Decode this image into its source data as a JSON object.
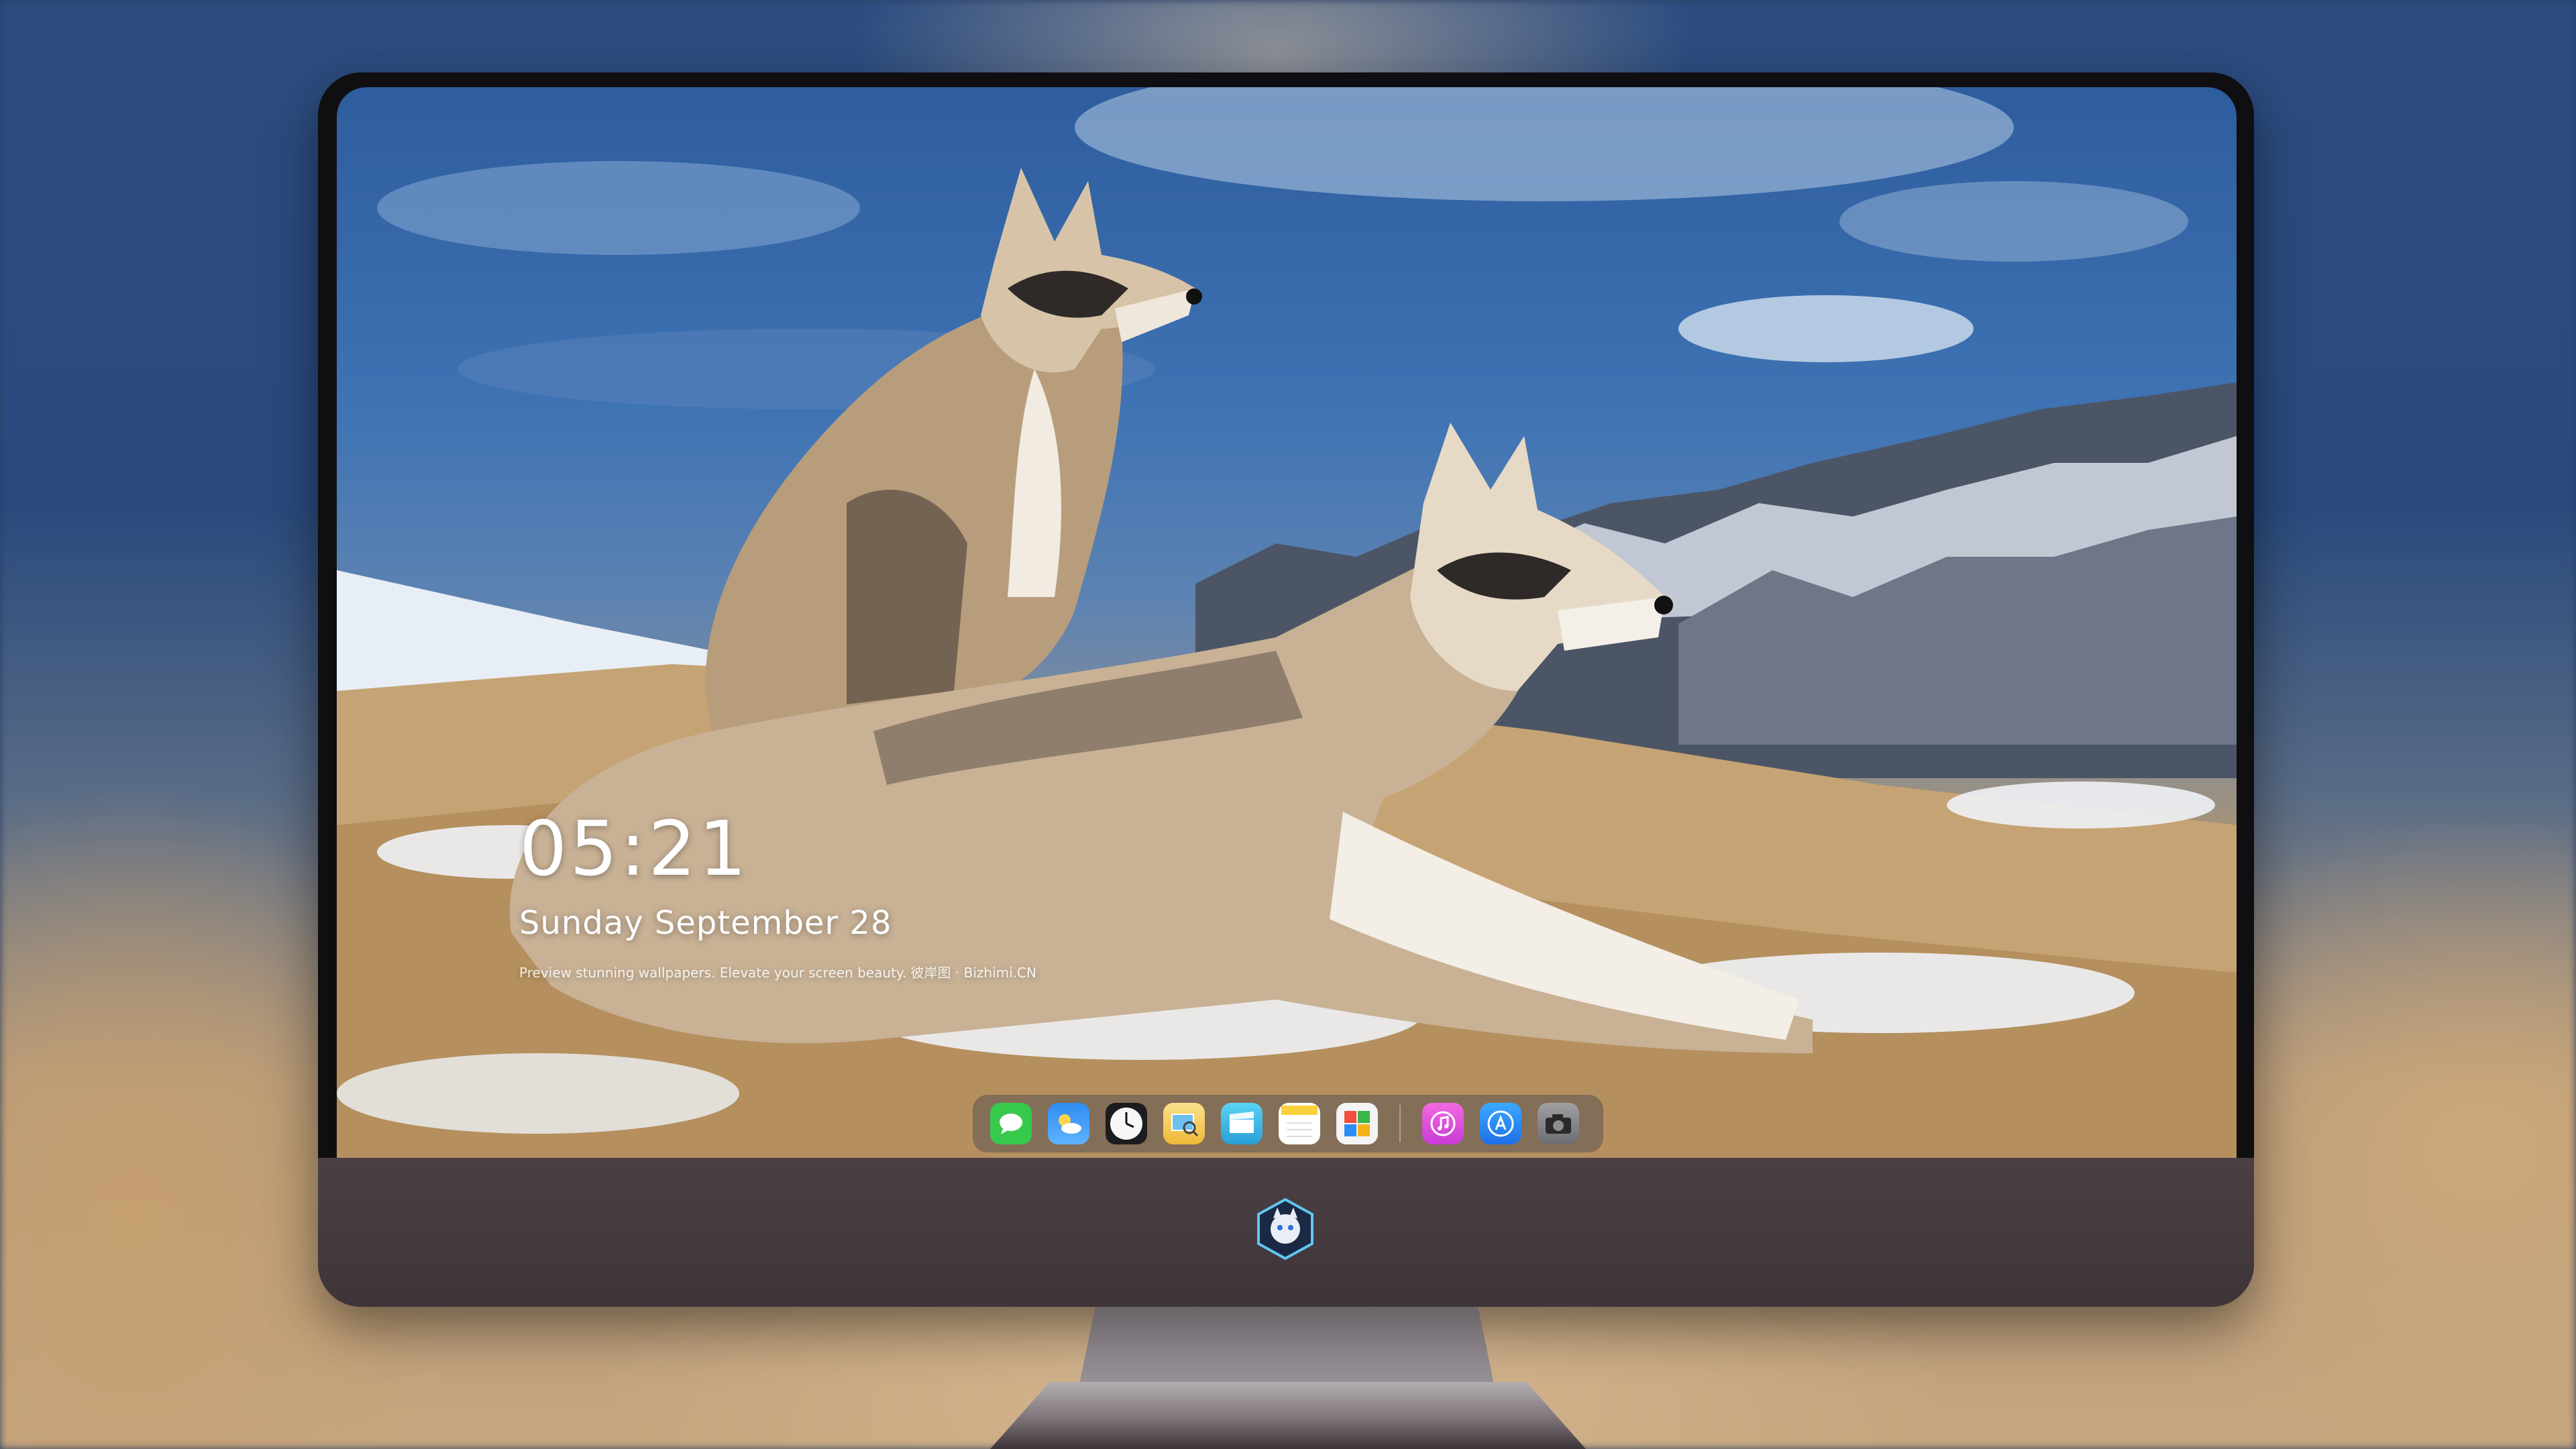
{
  "lockscreen": {
    "time": "05:21",
    "date": "Sunday September  28",
    "caption": "Preview stunning wallpapers. Elevate your screen beauty. 彼岸图 · Bizhimi.CN"
  },
  "dock": {
    "apps": [
      {
        "name": "messages-icon",
        "color": "#37c94b",
        "glyph": "💬"
      },
      {
        "name": "weather-icon",
        "color": "#2f8cf0",
        "glyph": "☁"
      },
      {
        "name": "clock-icon",
        "color": "#f2f2f2",
        "glyph": "🕓"
      },
      {
        "name": "preview-icon",
        "color": "#f3c44e",
        "glyph": "🔍"
      },
      {
        "name": "clips-icon",
        "color": "#39b6e3",
        "glyph": "🎬"
      },
      {
        "name": "notes-icon",
        "color": "#fbd13d",
        "glyph": "☰"
      },
      {
        "name": "photos-app-icon",
        "color": "#f4f4f4",
        "glyph": "▦"
      },
      {
        "name": "music-icon",
        "color": "#e44fd8",
        "glyph": "♫"
      },
      {
        "name": "app-store-icon",
        "color": "#2d8df5",
        "glyph": "Ⓐ"
      },
      {
        "name": "camera-icon",
        "color": "#8d8d8f",
        "glyph": "📷"
      }
    ]
  },
  "colors": {
    "monitor_bezel": "#0f0f12",
    "chin": "#43393e",
    "sky": "#3e73b4",
    "snow": "#e8eef5",
    "grass": "#c6a374"
  }
}
